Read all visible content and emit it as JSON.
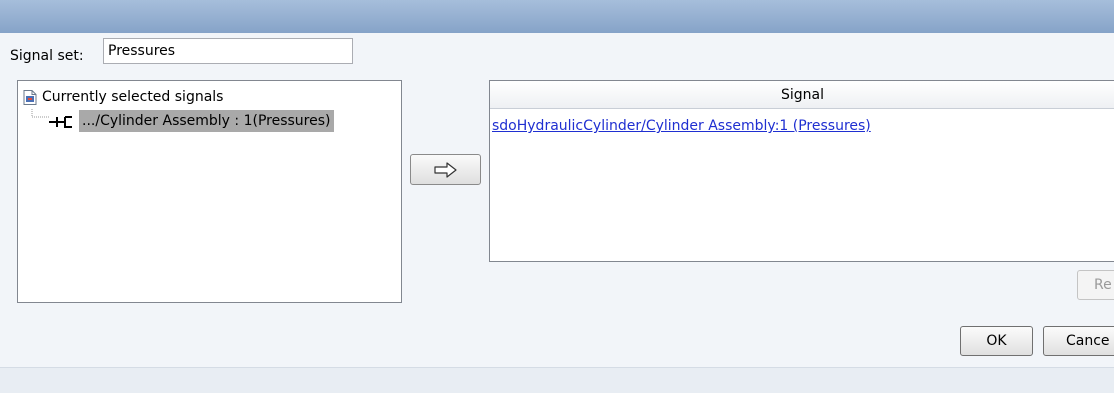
{
  "window": {
    "title": ""
  },
  "signal_set": {
    "label": "Signal set:",
    "value": "Pressures"
  },
  "tree": {
    "root_label": "Currently selected signals",
    "children": [
      {
        "label": ".../Cylinder Assembly : 1(Pressures)"
      }
    ]
  },
  "add_button": {
    "icon": "right-arrow-icon"
  },
  "table": {
    "header": "Signal",
    "rows": [
      {
        "signal": "sdoHydraulicCylinder/Cylinder Assembly:1 (Pressures)"
      }
    ]
  },
  "buttons": {
    "remove": "Re",
    "ok": "OK",
    "cancel": "Cance"
  },
  "colors": {
    "link": "#1f2fd1",
    "selection": "#a9a9a9",
    "titlebar": "#8fa9cc"
  }
}
